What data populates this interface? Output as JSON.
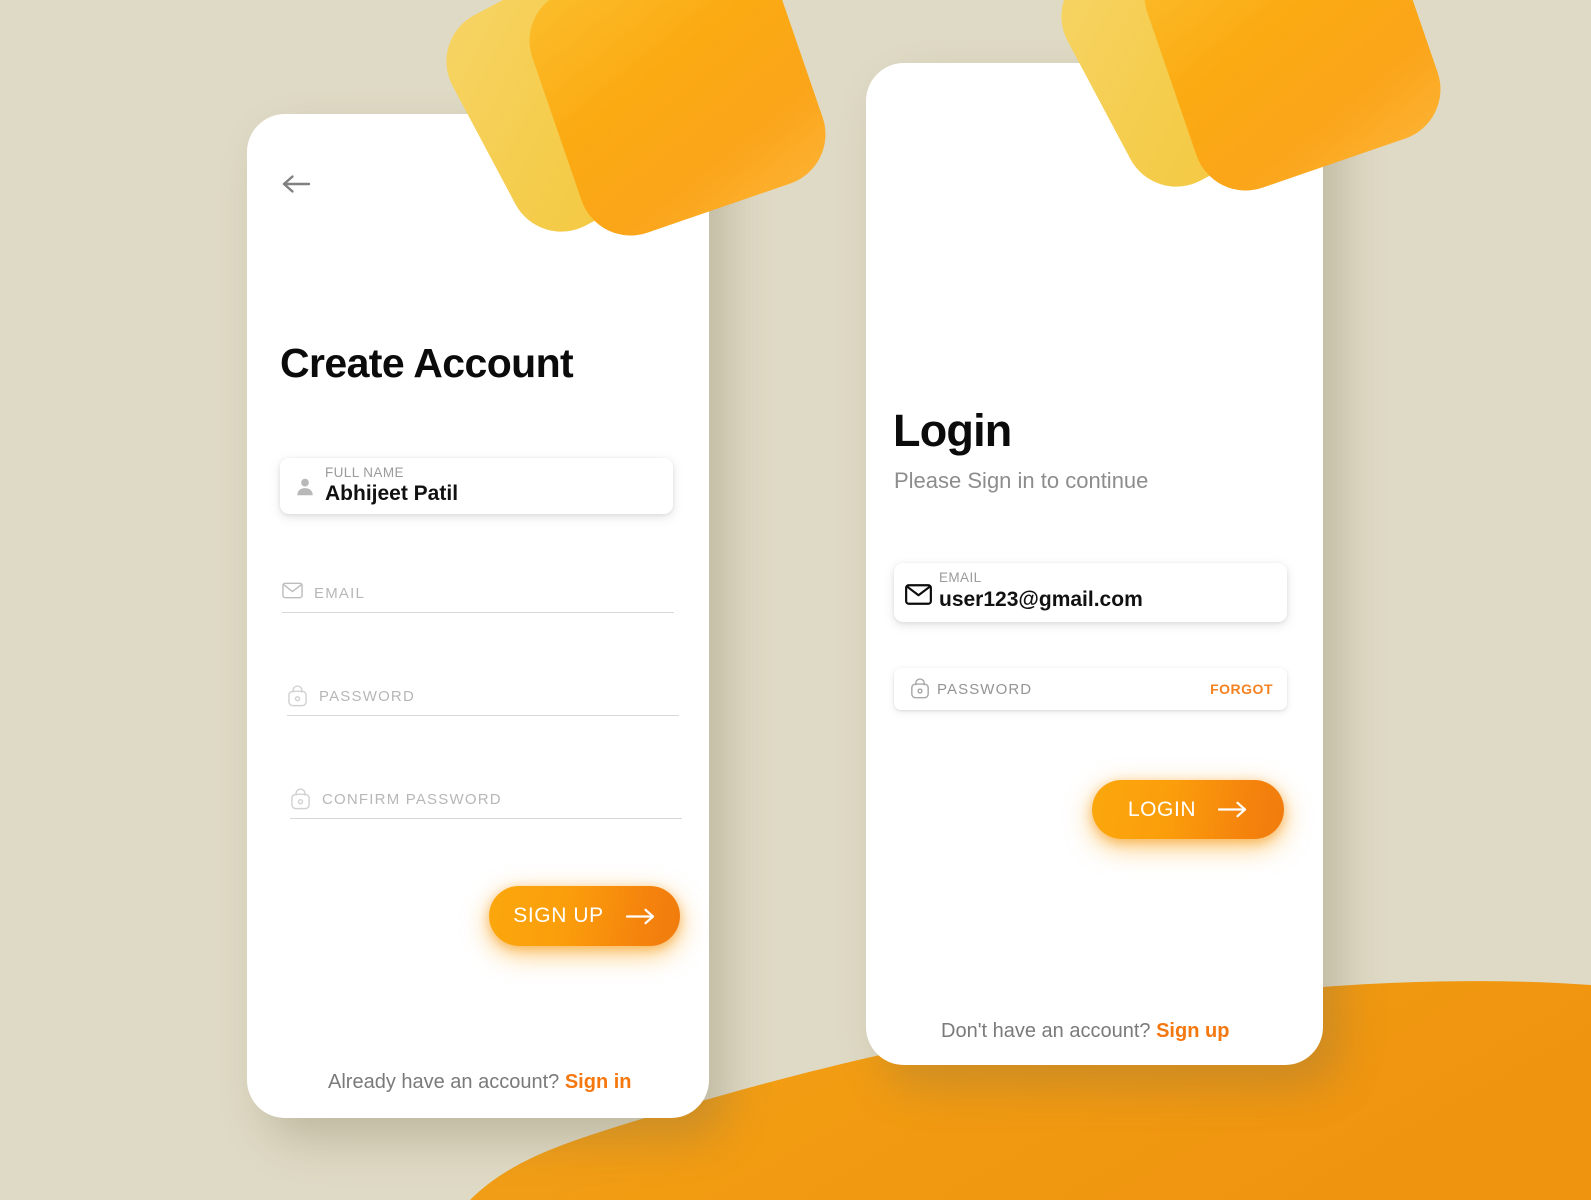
{
  "theme": {
    "background": "#dfdac5",
    "wave": "#f09a1a",
    "accent": "#f5840d",
    "accent_light": "#fbbe2c",
    "card": "#ffffff",
    "muted_text": "#9b9b9b"
  },
  "signup_screen": {
    "back_icon": "arrow-left-icon",
    "title": "Create Account",
    "fields": {
      "full_name": {
        "label": "FULL NAME",
        "value": "Abhijeet Patil",
        "icon": "person-icon"
      },
      "email": {
        "placeholder": "EMAIL",
        "value": "",
        "icon": "envelope-icon"
      },
      "password": {
        "placeholder": "PASSWORD",
        "value": "",
        "icon": "lock-icon"
      },
      "confirm_password": {
        "placeholder": "CONFIRM PASSWORD",
        "value": "",
        "icon": "lock-icon"
      }
    },
    "submit_button": {
      "label": "SIGN UP",
      "icon": "arrow-right-icon"
    },
    "footer": {
      "text": "Already have an account?",
      "link": "Sign in"
    }
  },
  "login_screen": {
    "title": "Login",
    "subtitle": "Please Sign in to continue",
    "fields": {
      "email": {
        "label": "EMAIL",
        "value": "user123@gmail.com",
        "icon": "envelope-icon"
      },
      "password": {
        "placeholder": "PASSWORD",
        "value": "",
        "icon": "lock-icon",
        "forgot_label": "FORGOT"
      }
    },
    "submit_button": {
      "label": "LOGIN",
      "icon": "arrow-right-icon"
    },
    "footer": {
      "text": "Don't have an account?",
      "link": "Sign up"
    }
  }
}
